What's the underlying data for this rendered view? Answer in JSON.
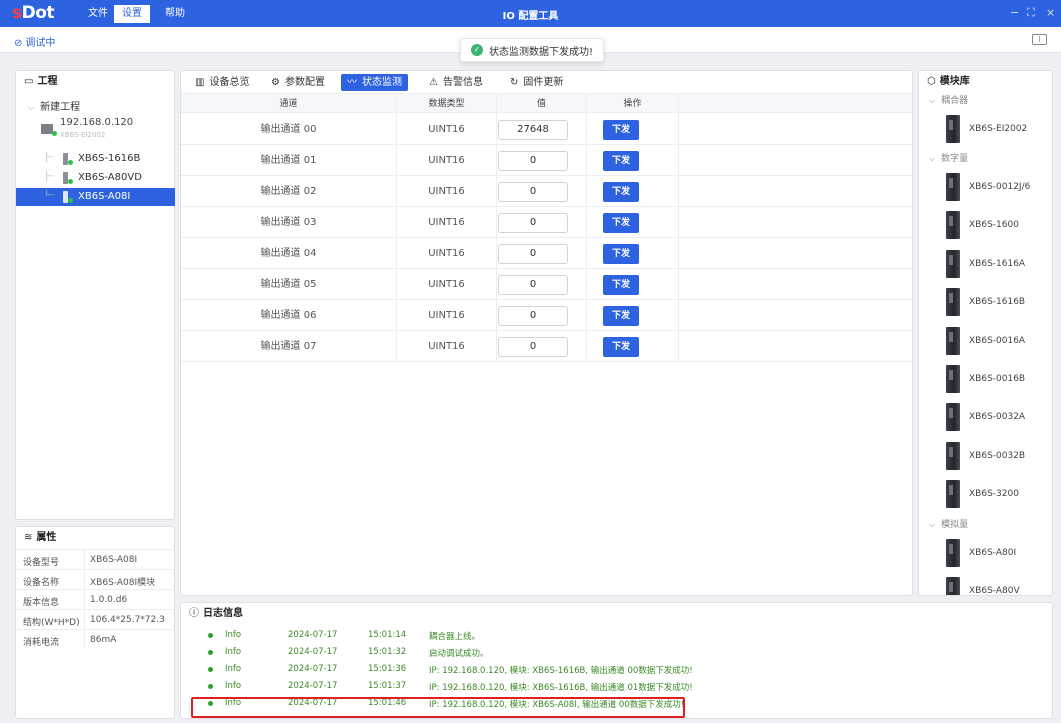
{
  "app": {
    "logo_s": "s",
    "logo_rest": "Dot",
    "title": "IO 配置工具",
    "menu": [
      "文件",
      "设置",
      "帮助"
    ],
    "controls": [
      "−",
      "⛶",
      "×"
    ]
  },
  "toolbar": {
    "debug_label": "调试中",
    "collapse_icon": "⟩"
  },
  "toast": {
    "message": "状态监测数据下发成功!"
  },
  "project": {
    "title": "工程",
    "root": "新建工程",
    "device_ip": "192.168.0.120",
    "device_model": "XB6S-EI2002",
    "modules": [
      "XB6S-1616B",
      "XB6S-A80VD",
      "XB6S-A08I"
    ],
    "selected_index": 2
  },
  "properties": {
    "title": "属性",
    "rows": [
      {
        "k": "设备型号",
        "v": "XB6S-A08I"
      },
      {
        "k": "设备名称",
        "v": "XB6S-A08I模块"
      },
      {
        "k": "版本信息",
        "v": "1.0.0.d6"
      },
      {
        "k": "结构(W*H*D)",
        "v": "106.4*25.7*72.3"
      },
      {
        "k": "消耗电流",
        "v": "86mA"
      }
    ]
  },
  "tabs": [
    {
      "icon": "▥",
      "label": "设备总览"
    },
    {
      "icon": "⚙",
      "label": "参数配置"
    },
    {
      "icon": "〰",
      "label": "状态监测"
    },
    {
      "icon": "⚠",
      "label": "告警信息"
    },
    {
      "icon": "↻",
      "label": "固件更新"
    }
  ],
  "active_tab": 2,
  "table": {
    "headers": [
      "通道",
      "数据类型",
      "值",
      "操作"
    ],
    "send_label": "下发",
    "rows": [
      {
        "channel": "输出通道 00",
        "type": "UINT16",
        "value": "27648"
      },
      {
        "channel": "输出通道 01",
        "type": "UINT16",
        "value": "0"
      },
      {
        "channel": "输出通道 02",
        "type": "UINT16",
        "value": "0"
      },
      {
        "channel": "输出通道 03",
        "type": "UINT16",
        "value": "0"
      },
      {
        "channel": "输出通道 04",
        "type": "UINT16",
        "value": "0"
      },
      {
        "channel": "输出通道 05",
        "type": "UINT16",
        "value": "0"
      },
      {
        "channel": "输出通道 06",
        "type": "UINT16",
        "value": "0"
      },
      {
        "channel": "输出通道 07",
        "type": "UINT16",
        "value": "0"
      }
    ]
  },
  "library": {
    "title": "模块库",
    "categories": [
      {
        "name": "耦合器",
        "items": [
          "XB6S-EI2002"
        ]
      },
      {
        "name": "数字量",
        "items": [
          "XB6S-0012J/6",
          "XB6S-1600",
          "XB6S-1616A",
          "XB6S-1616B",
          "XB6S-0016A",
          "XB6S-0016B",
          "XB6S-0032A",
          "XB6S-0032B",
          "XB6S-3200"
        ]
      },
      {
        "name": "模拟量",
        "items": [
          "XB6S-A80I",
          "XB6S-A80V"
        ]
      }
    ]
  },
  "log": {
    "title": "日志信息",
    "entries": [
      {
        "level": "Info",
        "date": "2024-07-17",
        "time": "15:01:14",
        "msg": "耦合器上线。"
      },
      {
        "level": "Info",
        "date": "2024-07-17",
        "time": "15:01:32",
        "msg": "启动调试成功。"
      },
      {
        "level": "Info",
        "date": "2024-07-17",
        "time": "15:01:36",
        "msg": "IP: 192.168.0.120, 模块: XB6S-1616B, 输出通道 00数据下发成功!"
      },
      {
        "level": "Info",
        "date": "2024-07-17",
        "time": "15:01:37",
        "msg": "IP: 192.168.0.120, 模块: XB6S-1616B, 输出通道 01数据下发成功!"
      },
      {
        "level": "Info",
        "date": "2024-07-17",
        "time": "15:01:46",
        "msg": "IP: 192.168.0.120, 模块: XB6S-A08I, 输出通道 00数据下发成功!"
      }
    ]
  },
  "colors": {
    "accent": "#2d63e0",
    "success": "#2fa02f",
    "highlight": "#e02020"
  }
}
